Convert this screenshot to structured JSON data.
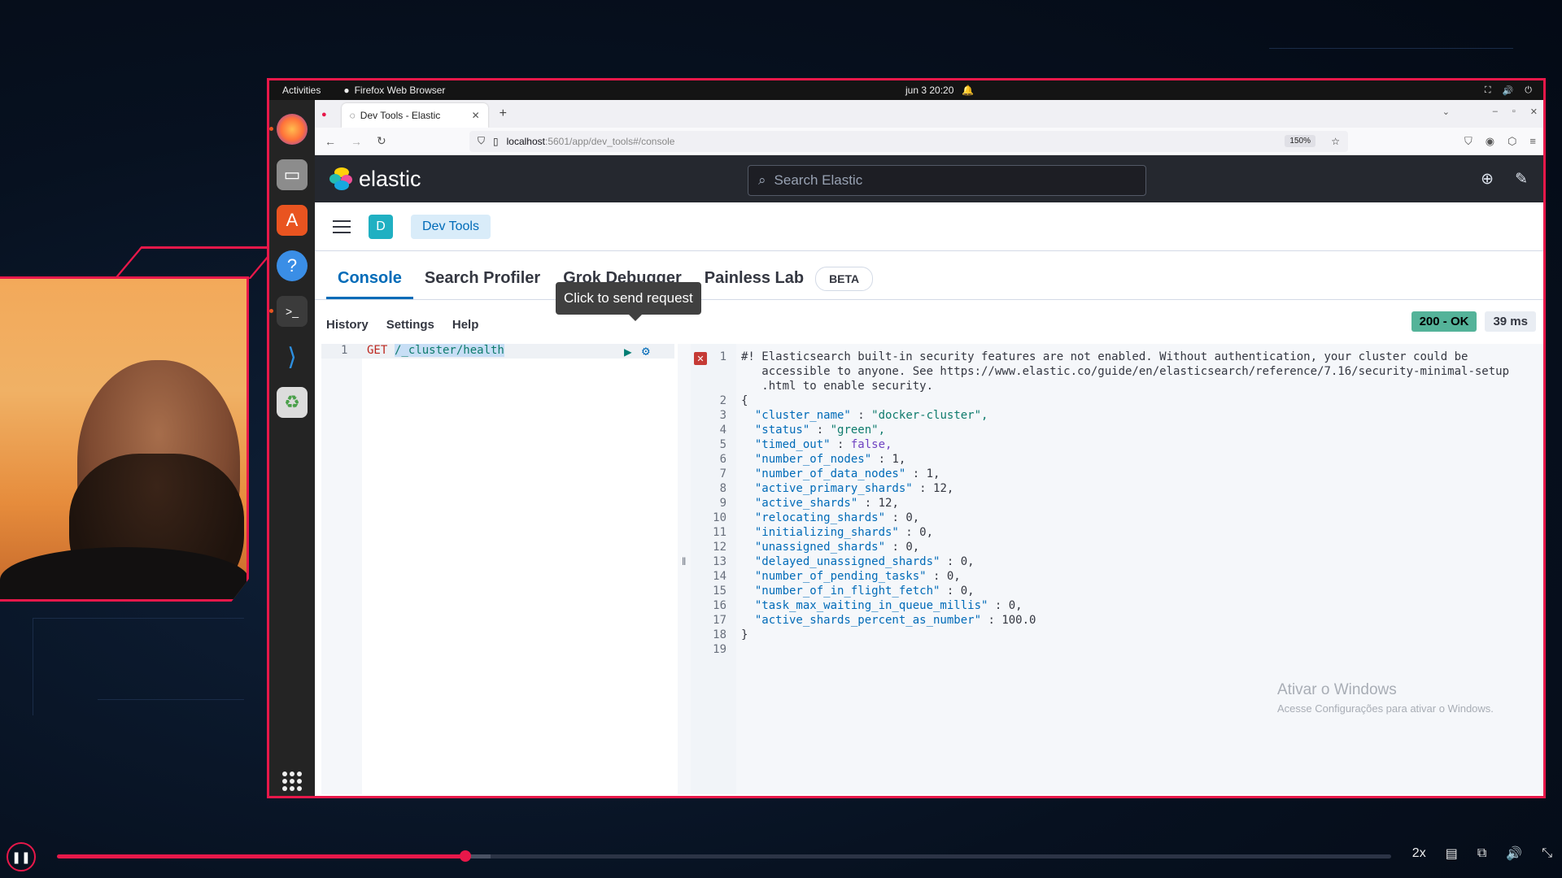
{
  "os": {
    "activities": "Activities",
    "app_name": "Firefox Web Browser",
    "clock": "jun 3  20:20",
    "dock_icons": [
      "firefox-icon",
      "files-icon",
      "software-store-icon",
      "help-icon",
      "terminal-icon",
      "vscode-icon",
      "trash-icon"
    ]
  },
  "browser": {
    "tab_title": "Dev Tools - Elastic",
    "url_host": "localhost",
    "url_path": ":5601/app/dev_tools#/console",
    "zoom": "150%"
  },
  "kibana": {
    "brand": "elastic",
    "search_placeholder": "Search Elastic",
    "avatar_letter": "D",
    "breadcrumb": "Dev Tools",
    "tabs": [
      {
        "label": "Console",
        "selected": true
      },
      {
        "label": "Search Profiler",
        "selected": false
      },
      {
        "label": "Grok Debugger",
        "selected": false
      },
      {
        "label": "Painless Lab",
        "selected": false
      }
    ],
    "beta_badge": "BETA",
    "tooltip": "Click to send request",
    "menu": [
      "History",
      "Settings",
      "Help"
    ],
    "status_code": "200 - OK",
    "duration": "39 ms",
    "request": {
      "line": "1",
      "method": "GET",
      "path": "/_cluster/health"
    },
    "response_lines": [
      {
        "n": "1",
        "text": "#! Elasticsearch built-in security features are not enabled. Without authentication, your cluster could be"
      },
      {
        "n": "",
        "text": "   accessible to anyone. See https://www.elastic.co/guide/en/elasticsearch/reference/7.16/security-minimal-setup"
      },
      {
        "n": "",
        "text": "   .html to enable security."
      },
      {
        "n": "2",
        "text": "{"
      },
      {
        "n": "3",
        "text": "  \"cluster_name\" : \"docker-cluster\","
      },
      {
        "n": "4",
        "text": "  \"status\" : \"green\","
      },
      {
        "n": "5",
        "text": "  \"timed_out\" : false,"
      },
      {
        "n": "6",
        "text": "  \"number_of_nodes\" : 1,"
      },
      {
        "n": "7",
        "text": "  \"number_of_data_nodes\" : 1,"
      },
      {
        "n": "8",
        "text": "  \"active_primary_shards\" : 12,"
      },
      {
        "n": "9",
        "text": "  \"active_shards\" : 12,"
      },
      {
        "n": "10",
        "text": "  \"relocating_shards\" : 0,"
      },
      {
        "n": "11",
        "text": "  \"initializing_shards\" : 0,"
      },
      {
        "n": "12",
        "text": "  \"unassigned_shards\" : 0,"
      },
      {
        "n": "13",
        "text": "  \"delayed_unassigned_shards\" : 0,"
      },
      {
        "n": "14",
        "text": "  \"number_of_pending_tasks\" : 0,"
      },
      {
        "n": "15",
        "text": "  \"number_of_in_flight_fetch\" : 0,"
      },
      {
        "n": "16",
        "text": "  \"task_max_waiting_in_queue_millis\" : 0,"
      },
      {
        "n": "17",
        "text": "  \"active_shards_percent_as_number\" : 100.0"
      },
      {
        "n": "18",
        "text": "}"
      },
      {
        "n": "19",
        "text": ""
      }
    ]
  },
  "watermark": {
    "title": "Ativar o Windows",
    "subtitle": "Acesse Configurações para ativar o Windows."
  },
  "player": {
    "progress": 0.306,
    "buffered": 0.325,
    "speed": "2x"
  }
}
